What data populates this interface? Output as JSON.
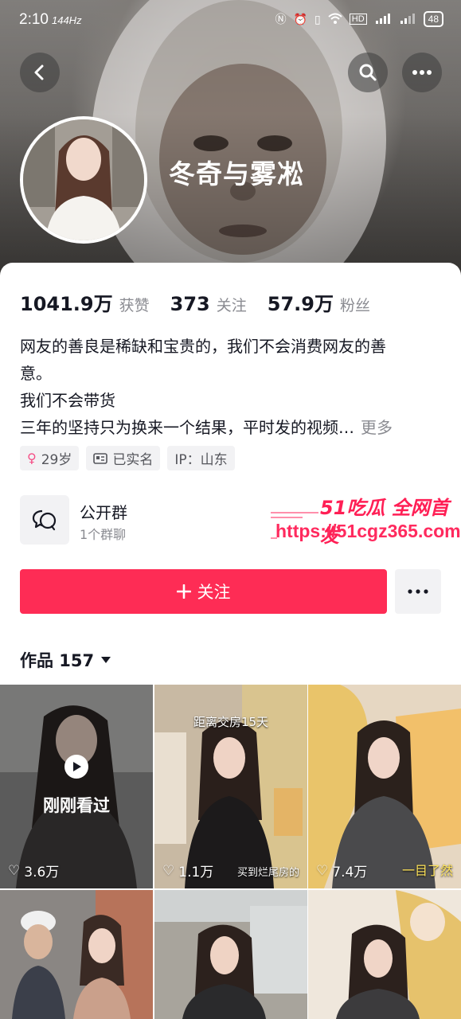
{
  "status_bar": {
    "time": "2:10",
    "refresh": "144Hz",
    "icons": [
      "nfc-icon",
      "alarm-icon",
      "vibrate-icon",
      "wifi-icon",
      "hd-icon",
      "signal-4g-icon",
      "signal-4g-icon"
    ],
    "battery": "48"
  },
  "header": {
    "back_icon": "chevron-left-icon",
    "search_icon": "search-icon",
    "more_icon": "ellipsis-icon",
    "nickname": "冬奇与雾凇"
  },
  "stats": [
    {
      "value": "1041.9万",
      "label": "获赞"
    },
    {
      "value": "373",
      "label": "关注"
    },
    {
      "value": "57.9万",
      "label": "粉丝"
    }
  ],
  "bio": {
    "line1": "网友的善良是稀缺和宝贵的，我们不会消费网友的善",
    "line2": "意。",
    "line3": "我们不会带货",
    "line4": "三年的坚持只为换来一个结果，平时发的视频…",
    "more": "更多"
  },
  "tags": [
    {
      "icon": "female-icon",
      "text": "29岁"
    },
    {
      "icon": "id-card-icon",
      "text": "已实名"
    },
    {
      "icon": "",
      "text": "IP：山东"
    }
  ],
  "group": {
    "icon": "chat-bubbles-icon",
    "title": "公开群",
    "subtitle": "1个群聊"
  },
  "watermark": {
    "title": "51吃瓜 全网首发",
    "url": "https://51cgz365.com"
  },
  "actions": {
    "follow_label": "关注",
    "more_icon": "ellipsis-icon"
  },
  "works": {
    "label": "作品 157"
  },
  "videos": [
    {
      "likes": "3.6万",
      "seen": "刚刚看过",
      "caption_top": "",
      "caption_bottom": ""
    },
    {
      "likes": "1.1万",
      "seen": "",
      "caption_top": "距离交房15天",
      "caption_bottom": "买到烂尾房的"
    },
    {
      "likes": "7.4万",
      "seen": "",
      "caption_top": "",
      "caption_bottom": "一目了然"
    },
    {
      "likes": "",
      "seen": "",
      "caption_top": "",
      "caption_bottom": ""
    },
    {
      "likes": "",
      "seen": "",
      "caption_top": "",
      "caption_bottom": ""
    },
    {
      "likes": "",
      "seen": "",
      "caption_top": "",
      "caption_bottom": ""
    }
  ],
  "colors": {
    "accent": "#fe2c55",
    "text": "#161823",
    "secondary": "#8a8b91",
    "chip_bg": "#f2f2f4"
  }
}
